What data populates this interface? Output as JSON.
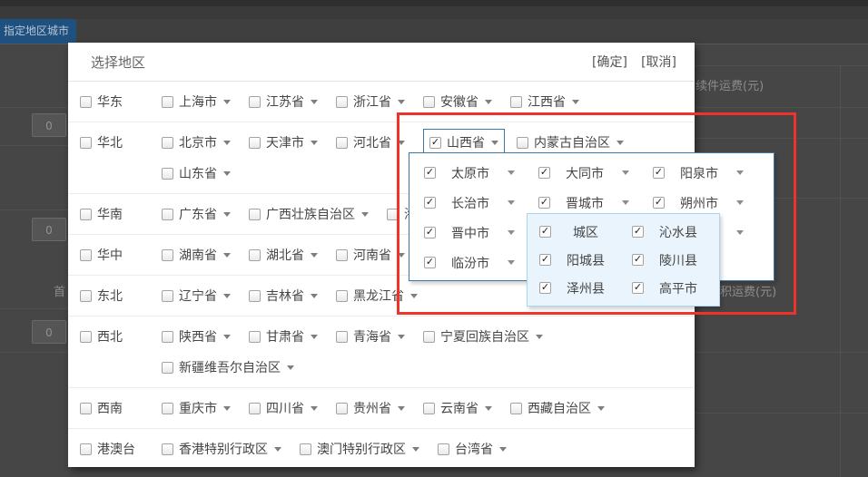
{
  "background": {
    "tab_label": "指定地区城市",
    "table_header_right": "续件运费(元)",
    "table_header_right2": "积运费(元)",
    "left_partial_label": "首",
    "input_values": [
      "0",
      "0",
      "0"
    ]
  },
  "dialog": {
    "title": "选择地区",
    "confirm_label": "[确定]",
    "cancel_label": "[取消]",
    "regions": [
      {
        "name": "华东",
        "checked": false,
        "lines": [
          [
            {
              "label": "上海市",
              "checked": false
            },
            {
              "label": "江苏省",
              "checked": false
            },
            {
              "label": "浙江省",
              "checked": false
            },
            {
              "label": "安徽省",
              "checked": false
            },
            {
              "label": "江西省",
              "checked": false
            }
          ]
        ]
      },
      {
        "name": "华北",
        "checked": false,
        "lines": [
          [
            {
              "label": "北京市",
              "checked": false
            },
            {
              "label": "天津市",
              "checked": false
            },
            {
              "label": "河北省",
              "checked": false
            },
            {
              "label": "山西省",
              "checked": true,
              "highlight": true
            },
            {
              "label": "内蒙古自治区",
              "checked": false
            }
          ],
          [
            {
              "label": "山东省",
              "checked": false
            }
          ]
        ]
      },
      {
        "name": "华南",
        "checked": false,
        "lines": [
          [
            {
              "label": "广东省",
              "checked": false
            },
            {
              "label": "广西壮族自治区",
              "checked": false
            },
            {
              "label": "海南省",
              "checked": false
            }
          ]
        ]
      },
      {
        "name": "华中",
        "checked": false,
        "lines": [
          [
            {
              "label": "湖南省",
              "checked": false
            },
            {
              "label": "湖北省",
              "checked": false
            },
            {
              "label": "河南省",
              "checked": false
            }
          ]
        ]
      },
      {
        "name": "东北",
        "checked": false,
        "lines": [
          [
            {
              "label": "辽宁省",
              "checked": false
            },
            {
              "label": "吉林省",
              "checked": false
            },
            {
              "label": "黑龙江省",
              "checked": false
            }
          ]
        ]
      },
      {
        "name": "西北",
        "checked": false,
        "lines": [
          [
            {
              "label": "陕西省",
              "checked": false
            },
            {
              "label": "甘肃省",
              "checked": false
            },
            {
              "label": "青海省",
              "checked": false
            },
            {
              "label": "宁夏回族自治区",
              "checked": false
            }
          ],
          [
            {
              "label": "新疆维吾尔自治区",
              "checked": false
            }
          ]
        ]
      },
      {
        "name": "西南",
        "checked": false,
        "lines": [
          [
            {
              "label": "重庆市",
              "checked": false
            },
            {
              "label": "四川省",
              "checked": false
            },
            {
              "label": "贵州省",
              "checked": false
            },
            {
              "label": "云南省",
              "checked": false
            },
            {
              "label": "西藏自治区",
              "checked": false
            }
          ]
        ]
      },
      {
        "name": "港澳台",
        "checked": false,
        "lines": [
          [
            {
              "label": "香港特别行政区",
              "checked": false
            },
            {
              "label": "澳门特别行政区",
              "checked": false
            },
            {
              "label": "台湾省",
              "checked": false
            }
          ]
        ]
      }
    ]
  },
  "city_panel": {
    "rows": [
      [
        {
          "label": "太原市",
          "checked": true
        },
        {
          "label": "大同市",
          "checked": true
        },
        {
          "label": "阳泉市",
          "checked": true
        }
      ],
      [
        {
          "label": "长治市",
          "checked": true
        },
        {
          "label": "晋城市",
          "checked": true
        },
        {
          "label": "朔州市",
          "checked": true
        }
      ],
      [
        {
          "label": "晋中市",
          "checked": true
        },
        {
          "empty": true
        },
        {
          "arrow_only": true
        }
      ],
      [
        {
          "label": "临汾市",
          "checked": true
        },
        {
          "empty": true
        },
        {
          "empty": true
        }
      ]
    ]
  },
  "county_panel": {
    "rows": [
      [
        {
          "label": "城区",
          "checked": true
        },
        {
          "label": "沁水县",
          "checked": true
        }
      ],
      [
        {
          "label": "阳城县",
          "checked": true
        },
        {
          "label": "陵川县",
          "checked": true
        }
      ],
      [
        {
          "label": "泽州县",
          "checked": true
        },
        {
          "label": "高平市",
          "checked": true
        }
      ]
    ]
  },
  "colors": {
    "panel_border": "#3878ab",
    "subpanel_bg": "#e9f4fc",
    "subpanel_border": "#aed5ee",
    "highlight_red": "#ee322c",
    "tab_bg": "#1e5180"
  }
}
